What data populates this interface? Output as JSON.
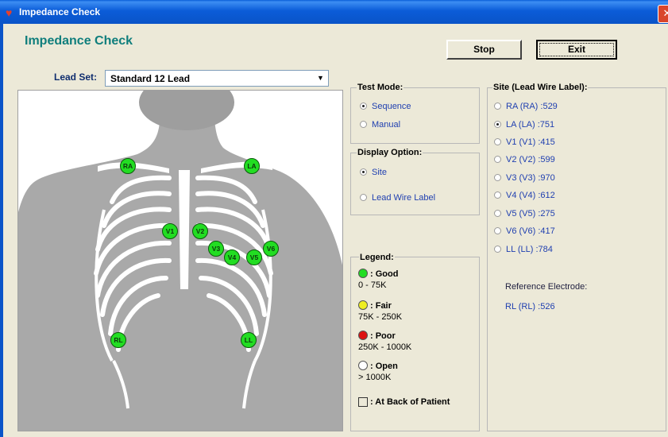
{
  "window": {
    "title": "Impedance Check",
    "close_glyph": "✕"
  },
  "main": {
    "title": "Impedance Check"
  },
  "buttons": {
    "stop": "Stop",
    "exit": "Exit"
  },
  "lead_set": {
    "label": "Lead Set:",
    "value": "Standard 12 Lead"
  },
  "electrodes": [
    "RA",
    "LA",
    "V1",
    "V2",
    "V3",
    "V4",
    "V5",
    "V6",
    "RL",
    "LL"
  ],
  "test_mode": {
    "title": "Test Mode:",
    "options": [
      "Sequence",
      "Manual"
    ],
    "selected": "Sequence"
  },
  "display_option": {
    "title": "Display Option:",
    "options": [
      "Site",
      "Lead Wire Label"
    ],
    "selected": "Site"
  },
  "legend": {
    "title": "Legend:",
    "items": [
      {
        "label": ": Good",
        "range": "0 - 75K",
        "color": "#22DD22"
      },
      {
        "label": ": Fair",
        "range": "75K - 250K",
        "color": "#EEEE22"
      },
      {
        "label": ": Poor",
        "range": "250K - 1000K",
        "color": "#DD1111"
      },
      {
        "label": ": Open",
        "range": "> 1000K",
        "color": "#FFFFFF"
      }
    ],
    "back_label": ": At Back of Patient"
  },
  "site": {
    "title": "Site (Lead Wire Label):",
    "options": [
      "RA (RA) :529",
      "LA (LA) :751",
      "V1 (V1) :415",
      "V2 (V2) :599",
      "V3 (V3) :970",
      "V4 (V4) :612",
      "V5 (V5) :275",
      "V6 (V6) :417",
      "LL (LL) :784"
    ],
    "selected": "LA (LA) :751",
    "reference_label": "Reference Electrode:",
    "reference_value": "RL (RL) :526"
  }
}
